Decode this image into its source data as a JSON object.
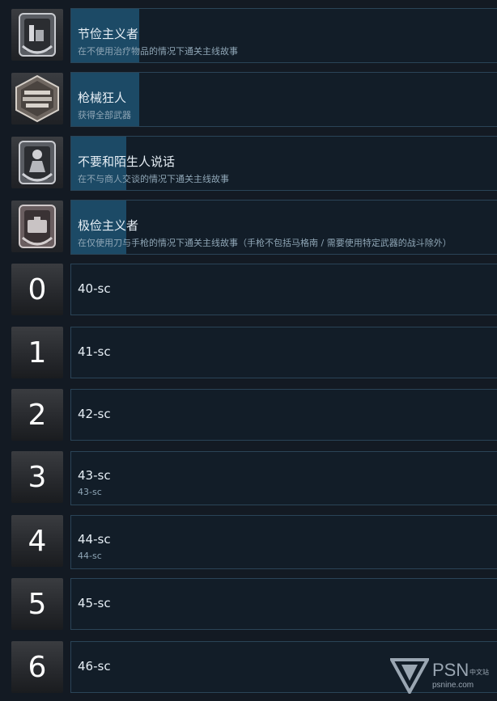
{
  "trophies": [
    {
      "title": "节俭主义者",
      "description": "在不使用治疗物品的情况下通关主线故事",
      "progress": 0.16,
      "icon": "laurel-items-badge-icon"
    },
    {
      "title": "枪械狂人",
      "description": "获得全部武器",
      "progress": 0.16,
      "icon": "firearms-hexagon-badge-icon"
    },
    {
      "title": "不要和陌生人说话",
      "description": "在不与商人交谈的情况下通关主线故事",
      "progress": 0.13,
      "icon": "merchant-laurel-badge-icon"
    },
    {
      "title": "极俭主义者",
      "description": "在仅使用刀与手枪的情况下通关主线故事（手枪不包括马格南 / 需要使用特定武器的战斗除外）",
      "progress": 0.13,
      "icon": "briefcase-laurel-badge-icon"
    }
  ],
  "items": [
    {
      "number": "0",
      "title": "40-sc",
      "description": ""
    },
    {
      "number": "1",
      "title": "41-sc",
      "description": ""
    },
    {
      "number": "2",
      "title": "42-sc",
      "description": ""
    },
    {
      "number": "3",
      "title": "43-sc",
      "description": "43-sc"
    },
    {
      "number": "4",
      "title": "44-sc",
      "description": "44-sc"
    },
    {
      "number": "5",
      "title": "45-sc",
      "description": ""
    },
    {
      "number": "6",
      "title": "46-sc",
      "description": ""
    }
  ],
  "watermark": {
    "brand": "PSN",
    "brand_cn": "中文站",
    "site": "psnine.com",
    "icon": "psnine-logo-icon"
  },
  "colors": {
    "background": "#131a23",
    "panel_border": "#2a4457",
    "progress_fill": "#1c4a66",
    "title_text": "#e6eef5",
    "description_text": "#8fa6b6"
  }
}
